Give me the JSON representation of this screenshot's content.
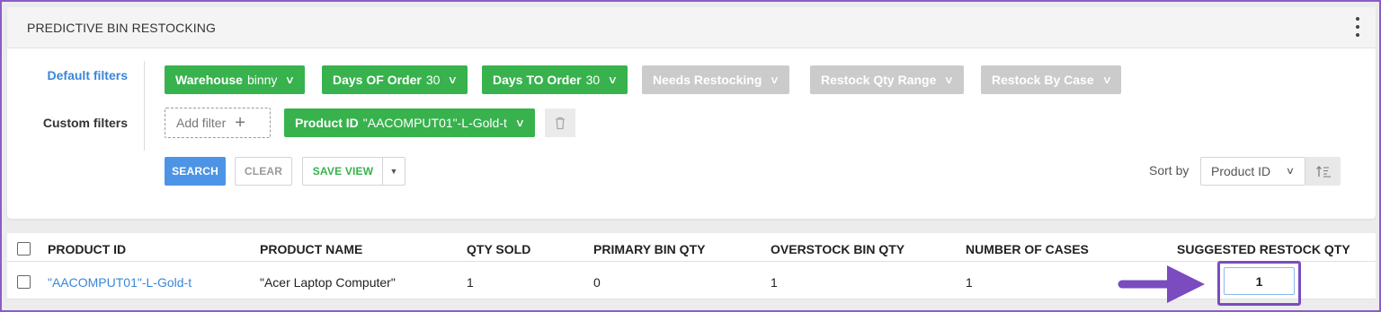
{
  "panel": {
    "title": "PREDICTIVE BIN RESTOCKING",
    "menu_icon": "kebab-menu-icon"
  },
  "filters": {
    "default_label": "Default filters",
    "custom_label": "Custom filters",
    "default": [
      {
        "label": "Warehouse",
        "value": "binny",
        "active": true
      },
      {
        "label": "Days OF Order",
        "value": "30",
        "active": true
      },
      {
        "label": "Days TO Order",
        "value": "30",
        "active": true
      },
      {
        "label": "Needs Restocking",
        "value": "",
        "active": false
      },
      {
        "label": "Restock Qty Range",
        "value": "",
        "active": false
      },
      {
        "label": "Restock By Case",
        "value": "",
        "active": false
      }
    ],
    "add_filter_label": "Add filter",
    "custom": [
      {
        "label": "Product ID",
        "value": "\"AACOMPUT01\"-L-Gold-t",
        "active": true
      }
    ]
  },
  "actions": {
    "search": "SEARCH",
    "clear": "CLEAR",
    "save_view": "SAVE VIEW"
  },
  "sort": {
    "label": "Sort by",
    "selected": "Product ID"
  },
  "table": {
    "columns": [
      "PRODUCT ID",
      "PRODUCT NAME",
      "QTY SOLD",
      "PRIMARY BIN QTY",
      "OVERSTOCK BIN QTY",
      "NUMBER OF CASES",
      "SUGGESTED RESTOCK QTY"
    ],
    "rows": [
      [
        "\"AACOMPUT01\"-L-Gold-t",
        "\"Acer Laptop Computer\"",
        "1",
        "0",
        "1",
        "1",
        "1"
      ]
    ]
  },
  "colors": {
    "active_chip": "#37b24d",
    "inactive_chip": "#cbcbcb",
    "primary": "#4d94e6",
    "link": "#3a86d8",
    "annotation": "#7a4cc0"
  }
}
